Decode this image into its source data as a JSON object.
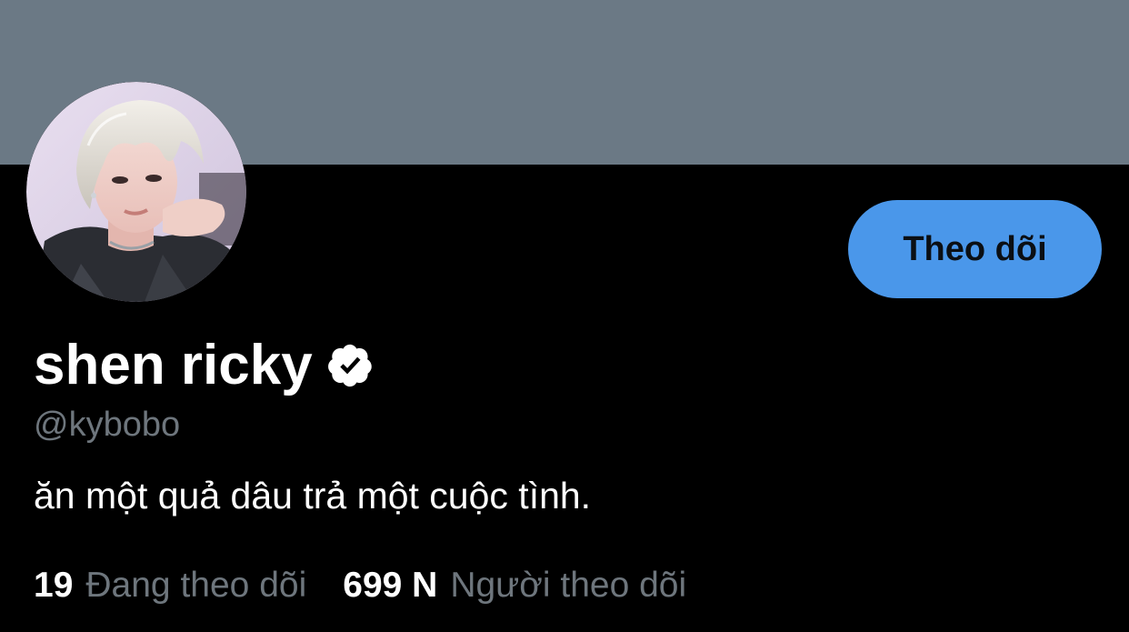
{
  "colors": {
    "banner": "#6b7985",
    "background": "#000000",
    "accent": "#4a97ea",
    "muted_text": "#6e767d",
    "primary_text": "#ffffff"
  },
  "profile": {
    "display_name": "shen ricky",
    "verified_icon": "verified-badge-icon",
    "handle": "@kybobo",
    "bio": "ăn một quả dâu trả một cuộc tình."
  },
  "actions": {
    "follow_label": "Theo dõi"
  },
  "stats": {
    "following_count": "19",
    "following_label": "Đang theo dõi",
    "followers_count": "699 N",
    "followers_label": "Người theo dõi"
  }
}
